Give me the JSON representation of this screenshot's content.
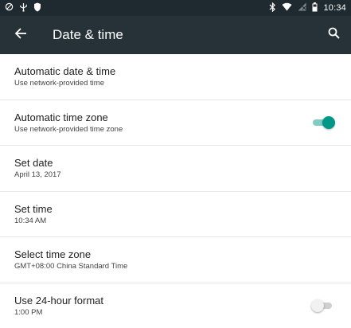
{
  "status_bar": {
    "time": "10:34",
    "left_icons": [
      "circle-slash-icon",
      "usb-icon",
      "shield-icon"
    ],
    "right_icons": [
      "bluetooth-icon",
      "wifi-icon",
      "no-signal-icon",
      "battery-icon"
    ]
  },
  "app_bar": {
    "title": "Date & time",
    "back_icon": "arrow-left-icon",
    "search_icon": "search-icon"
  },
  "settings": [
    {
      "title": "Automatic date & time",
      "subtitle": "Use network-provided time",
      "toggle": null
    },
    {
      "title": "Automatic time zone",
      "subtitle": "Use network-provided time zone",
      "toggle": true
    },
    {
      "title": "Set date",
      "subtitle": "April 13, 2017",
      "toggle": null
    },
    {
      "title": "Set time",
      "subtitle": "10:34 AM",
      "toggle": null
    },
    {
      "title": "Select time zone",
      "subtitle": "GMT+08:00 China Standard Time",
      "toggle": null
    },
    {
      "title": "Use 24-hour format",
      "subtitle": "1:00 PM",
      "toggle": false
    }
  ],
  "colors": {
    "status_bar": "#1f2a30",
    "app_bar": "#263238",
    "accent": "#009688",
    "accent_track": "#80cbc4"
  }
}
